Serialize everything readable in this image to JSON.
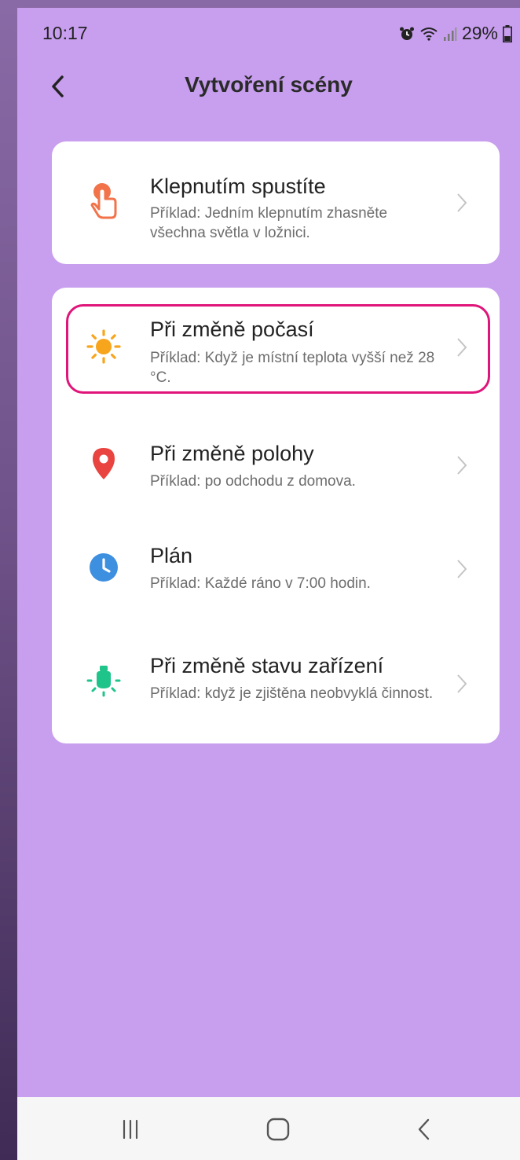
{
  "status_bar": {
    "time": "10:17",
    "battery": "29%",
    "icons": [
      "alarm-icon",
      "wifi-icon",
      "signal-icon",
      "battery-icon"
    ]
  },
  "header": {
    "title": "Vytvoření scény",
    "back_icon": "chevron-left-icon"
  },
  "options": [
    {
      "title": "Klepnutím spustíte",
      "description": "Příklad: Jedním klepnutím zhasněte všechna světla v ložnici.",
      "icon": "tap-hand-icon",
      "icon_color": "#f2734a"
    },
    {
      "title": "Při změně počasí",
      "description": "Příklad: Když je místní teplota vyšší než 28 °C.",
      "icon": "sun-icon",
      "icon_color": "#f7a51c",
      "highlighted": true
    },
    {
      "title": "Při změně polohy",
      "description": "Příklad: po odchodu z domova.",
      "icon": "location-pin-icon",
      "icon_color": "#e9443f"
    },
    {
      "title": "Plán",
      "description": "Příklad: Každé ráno v 7:00 hodin.",
      "icon": "clock-icon",
      "icon_color": "#3d8fe0"
    },
    {
      "title": "Při změně stavu zařízení",
      "description": "Příklad: když je zjištěna neobvyklá činnost.",
      "icon": "device-bulb-icon",
      "icon_color": "#1fc48a"
    }
  ],
  "colors": {
    "screen_background": "#c89eee",
    "card_background": "#ffffff",
    "highlight_border": "#e0157a"
  },
  "nav_bar": {
    "buttons": [
      "recent-apps-icon",
      "home-icon",
      "back-icon"
    ]
  }
}
